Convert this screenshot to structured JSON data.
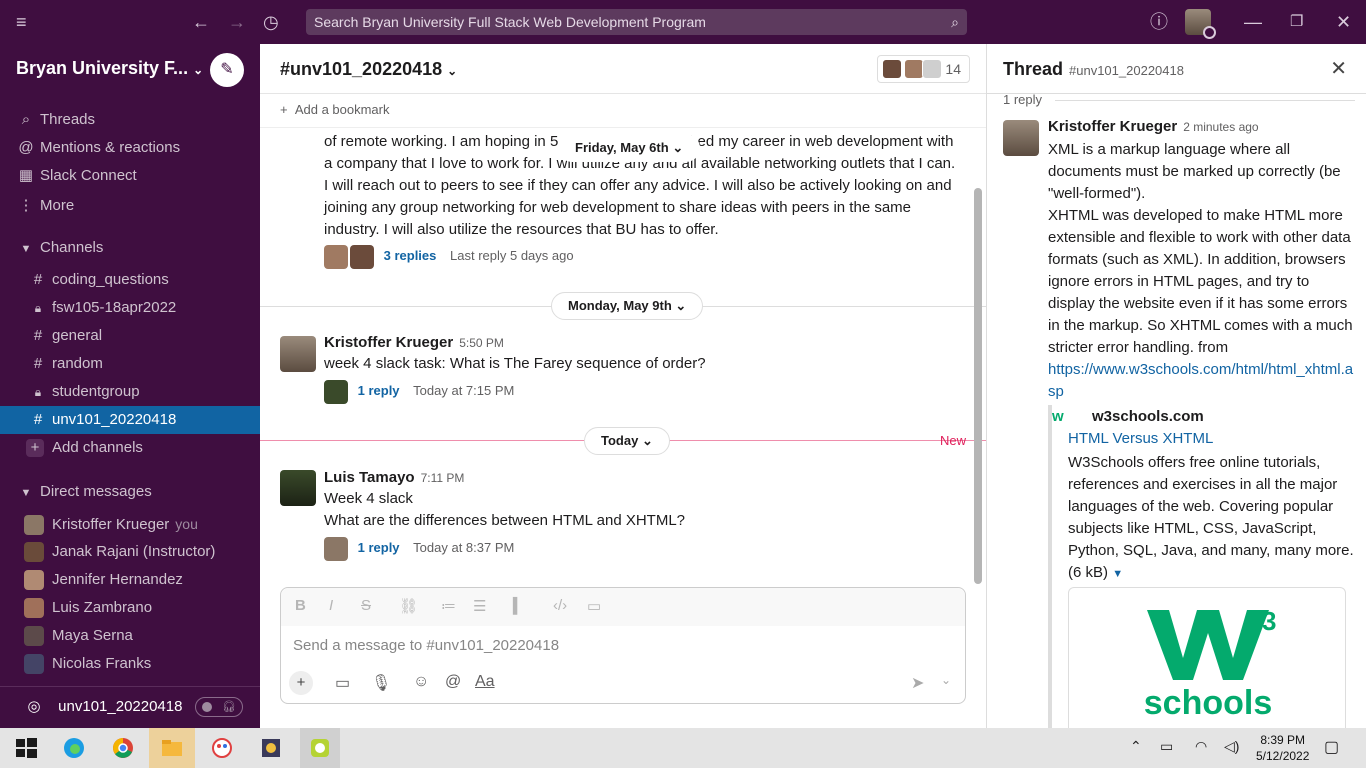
{
  "search": {
    "placeholder": "Search Bryan University Full Stack Web Development Program"
  },
  "workspace": {
    "name": "Bryan University F..."
  },
  "sidebar": {
    "nav": [
      {
        "label": "Threads",
        "icon": "threads-icon"
      },
      {
        "label": "Mentions & reactions",
        "icon": "at-icon"
      },
      {
        "label": "Slack Connect",
        "icon": "building-icon"
      },
      {
        "label": "More",
        "icon": "kebab-icon"
      }
    ],
    "channels_heading": "Channels",
    "channels": [
      {
        "name": "coding_questions",
        "private": false
      },
      {
        "name": "fsw105-18apr2022",
        "private": true
      },
      {
        "name": "general",
        "private": false
      },
      {
        "name": "random",
        "private": false
      },
      {
        "name": "studentgroup",
        "private": true
      },
      {
        "name": "unv101_20220418",
        "private": false,
        "active": true
      }
    ],
    "add_channels": "Add channels",
    "dm_heading": "Direct messages",
    "dms": [
      {
        "name": "Kristoffer Krueger",
        "you": "you"
      },
      {
        "name": "Janak Rajani (Instructor)"
      },
      {
        "name": "Jennifer Hernandez"
      },
      {
        "name": "Luis Zambrano"
      },
      {
        "name": "Maya Serna"
      },
      {
        "name": "Nicolas Franks"
      }
    ],
    "huddle_channel": "unv101_20220418"
  },
  "channel": {
    "title": "#unv101_20220418",
    "member_count": "14",
    "bookmark_label": "Add a bookmark"
  },
  "messages": {
    "prev_lines": [
      "of remote working.  I am hoping in 5",
      "a company that I love to work for.  I will utilize any and all available networking outlets that I can.",
      "I will reach out to peers to see if they can offer any advice.  I will also be actively looking on and",
      "joining any group networking for web development to share ideas with peers in the same",
      "industry.  I will also utilize the resources that BU has to offer."
    ],
    "prev_line1_tail": "ished my career in web development with",
    "prev_replies": {
      "link": "3 replies",
      "last": "Last reply 5 days ago"
    },
    "date1": "Friday, May 6th",
    "date2": "Monday, May 9th",
    "date3": "Today",
    "new_label": "New",
    "msg1": {
      "sender": "Kristoffer Krueger",
      "time": "5:50 PM",
      "text": "week 4 slack task: What is The Farey sequence of order?",
      "reply_link": "1 reply",
      "reply_last": "Today at 7:15 PM"
    },
    "msg2": {
      "sender": "Luis Tamayo",
      "time": "7:11 PM",
      "line1": "Week 4 slack",
      "line2": "What are the differences between HTML and XHTML?",
      "reply_link": "1 reply",
      "reply_last": "Today at 8:37 PM"
    }
  },
  "composer": {
    "placeholder": "Send a message to #unv101_20220418",
    "aa": "Aa"
  },
  "thread": {
    "title": "Thread",
    "channel": "#unv101_20220418",
    "reply_count": "1 reply",
    "sender": "Kristoffer Krueger",
    "time": "2 minutes ago",
    "para1": "XML is a markup language where all documents must be marked up correctly (be \"well-formed\").",
    "para2": "XHTML was developed to make HTML more extensible and flexible to work with other data formats (such as XML). In addition, browsers ignore errors in HTML pages, and try to display the website even if it has some errors in the markup. So XHTML comes with a much stricter error handling. from",
    "link": "https://www.w3schools.com/html/html_xhtml.asp",
    "unfurl": {
      "site": "w3schools.com",
      "title": "HTML Versus XHTML",
      "desc": "W3Schools offers free online tutorials, references and exercises in all the major languages of the web. Covering popular subjects like HTML, CSS, JavaScript, Python, SQL, Java, and many, many more.",
      "size": "(6 kB)"
    },
    "logo_text": "schools",
    "logo_sup": "3"
  },
  "taskbar": {
    "time": "8:39 PM",
    "date": "5/12/2022"
  },
  "colors": {
    "aubergine": "#3f0e40",
    "active": "#1164a3",
    "link": "#1264a3",
    "new": "#e01e5a",
    "w3green": "#04aa6d"
  }
}
